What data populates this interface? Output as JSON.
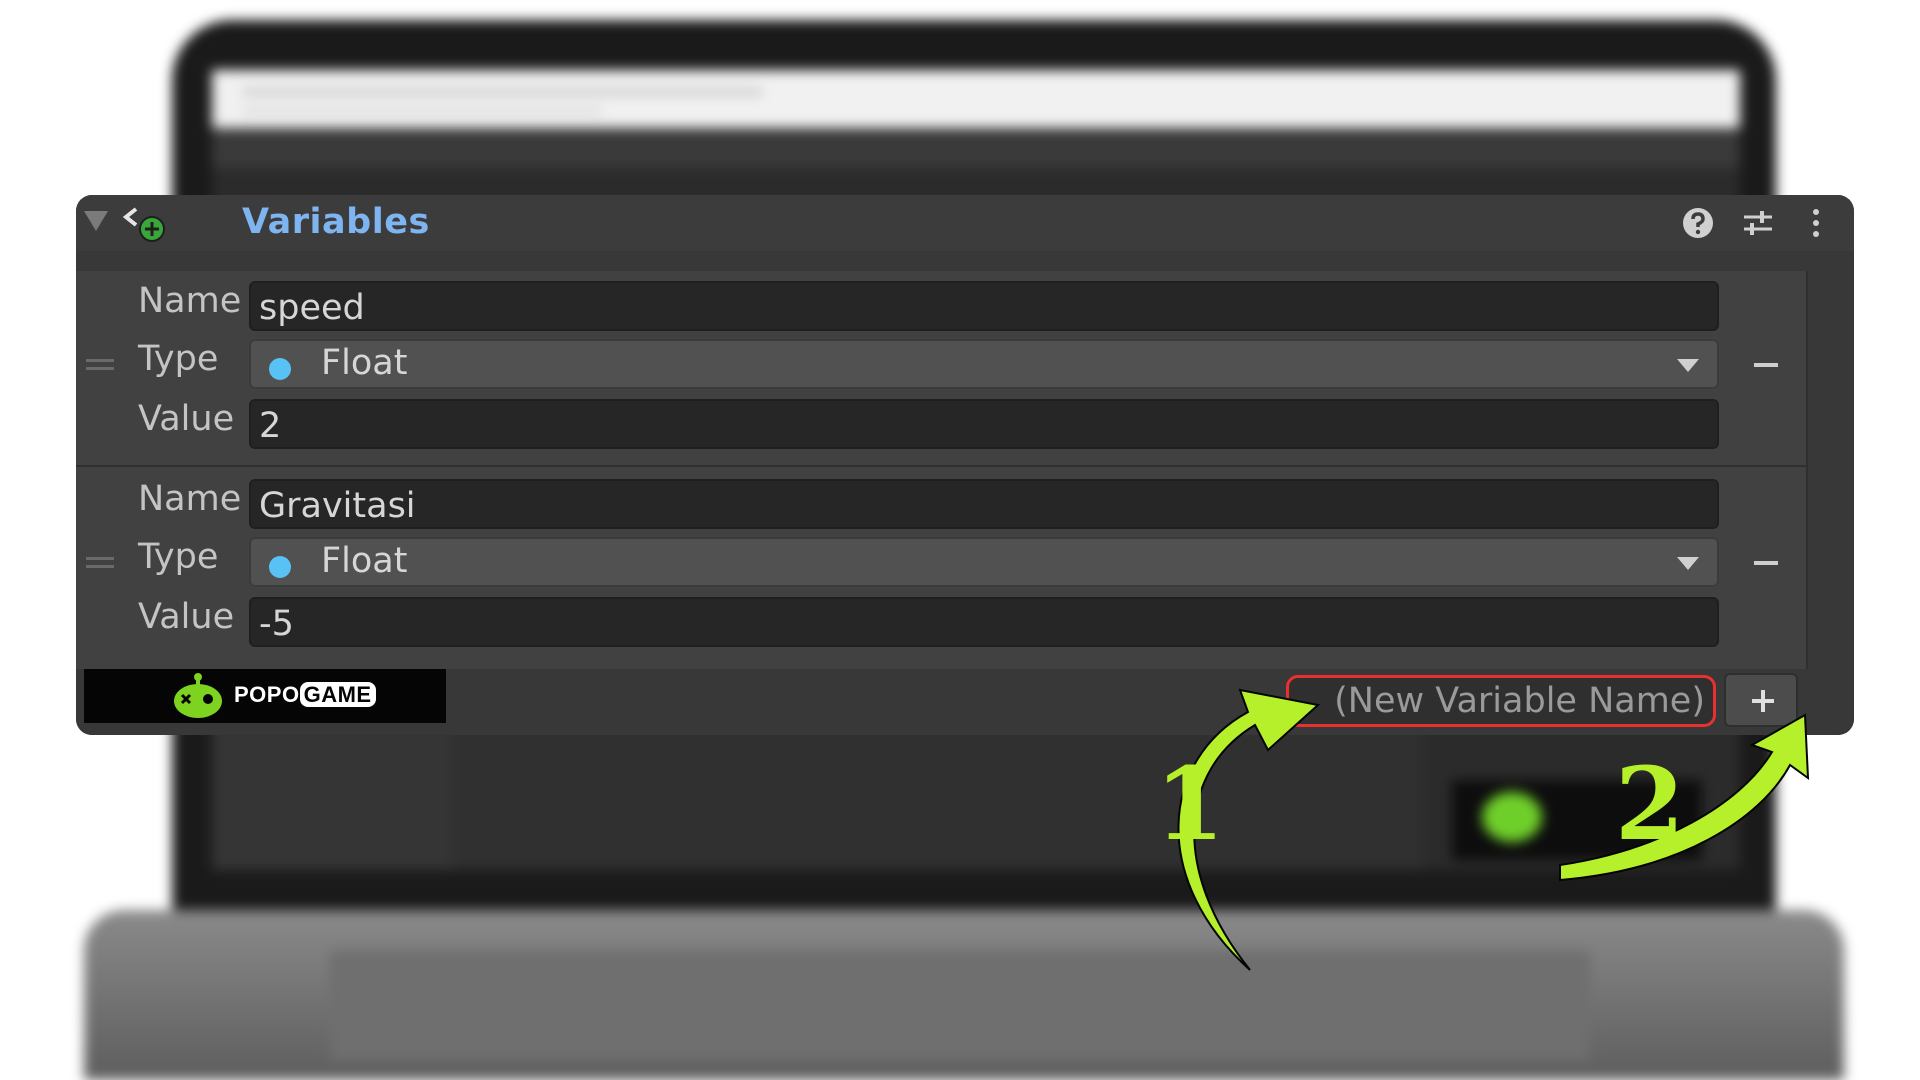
{
  "panel": {
    "title": "Variables"
  },
  "variables": [
    {
      "name_label": "Name",
      "name_value": "speed",
      "type_label": "Type",
      "type_value": "Float",
      "value_label": "Value",
      "value_value": "2"
    },
    {
      "name_label": "Name",
      "name_value": "Gravitasi",
      "type_label": "Type",
      "type_value": "Float",
      "value_label": "Value",
      "value_value": "-5"
    }
  ],
  "footer": {
    "new_variable_placeholder": "(New Variable Name)"
  },
  "annotations": {
    "step1": "1",
    "step2": "2"
  },
  "watermark": {
    "text_popo": "POPO",
    "text_game": "GAME"
  },
  "colors": {
    "title_blue": "#7eb4f0",
    "type_dot": "#59c2f4",
    "highlight_red": "#e83030",
    "arrow_green": "#b6f02a"
  },
  "icons": {
    "header": [
      "variables-icon",
      "help-icon",
      "settings-sliders-icon",
      "more-vertical-icon"
    ]
  }
}
